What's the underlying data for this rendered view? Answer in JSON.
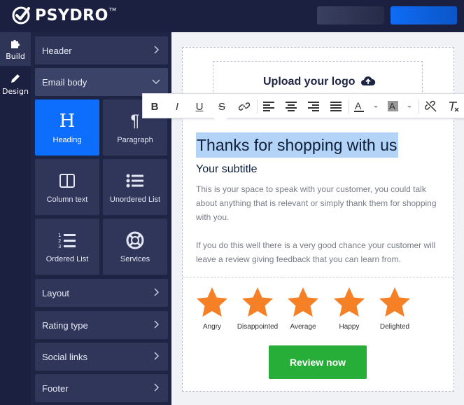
{
  "app": {
    "brand": "PSYDRO",
    "trademark": "TM"
  },
  "rail": [
    {
      "label": "Build",
      "icon": "puzzle-icon",
      "active": true
    },
    {
      "label": "Design",
      "icon": "pencil-icon",
      "active": false
    }
  ],
  "sidebar": {
    "sections": {
      "header": "Header",
      "email_body": "Email body",
      "layout": "Layout",
      "rating_type": "Rating type",
      "social_links": "Social links",
      "footer": "Footer"
    },
    "tiles": [
      {
        "label": "Heading",
        "icon": "heading-icon",
        "active": true
      },
      {
        "label": "Paragraph",
        "icon": "paragraph-icon",
        "active": false
      },
      {
        "label": "Column text",
        "icon": "columns-icon",
        "active": false
      },
      {
        "label": "Unordered List",
        "icon": "unordered-list-icon",
        "active": false
      },
      {
        "label": "Ordered List",
        "icon": "ordered-list-icon",
        "active": false
      },
      {
        "label": "Services",
        "icon": "lifebuoy-icon",
        "active": false
      }
    ]
  },
  "email": {
    "upload_logo": "Upload your logo",
    "heading": "Thanks for shopping with us",
    "subtitle": "Your subtitle",
    "paragraph1": "This is your space to speak with your customer, you could talk about anything that is relevant or simply thank them for shopping with you.",
    "paragraph2": "If you do this well there is a very good chance your customer will leave a review giving feedback that you can learn from.",
    "ratings": [
      "Angry",
      "Disappointed",
      "Average",
      "Happy",
      "Delighted"
    ],
    "review_button": "Review now"
  },
  "toolbar": {
    "bold": "B",
    "italic": "I",
    "underline": "U",
    "strikethrough": "S"
  },
  "colors": {
    "topbar": "#1b2040",
    "accent_blue": "#0d6efd",
    "star": "#f58025",
    "review_green": "#27ae39",
    "highlight": "#b4d4f7"
  }
}
